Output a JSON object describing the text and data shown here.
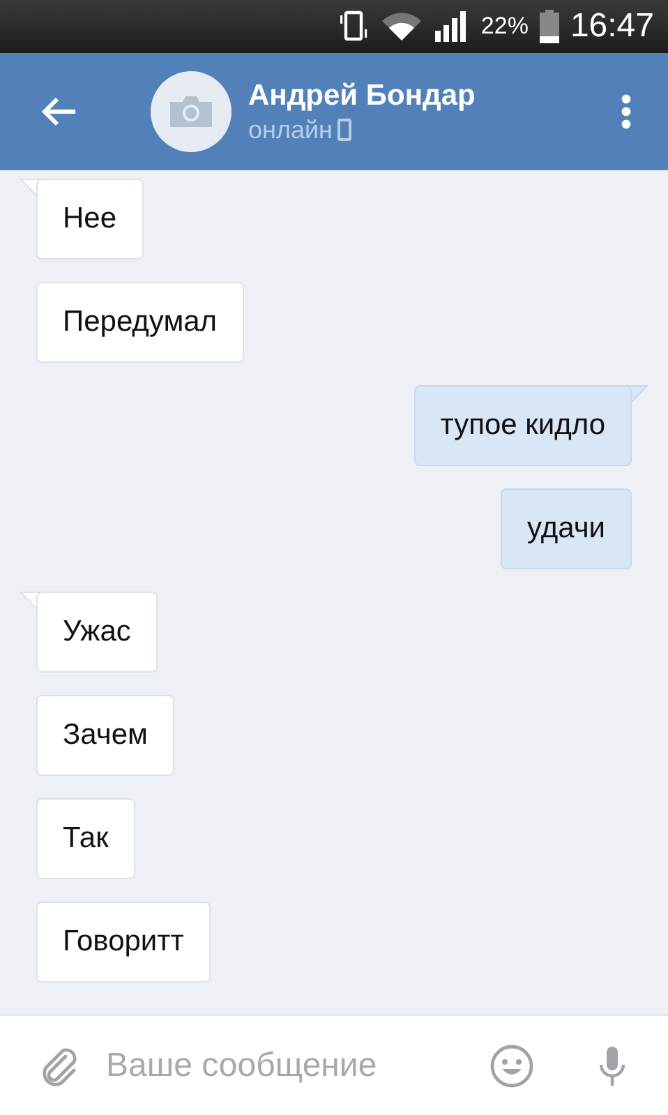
{
  "status_bar": {
    "battery": "22%",
    "time": "16:47"
  },
  "header": {
    "name": "Андрей Бондар",
    "status": "онлайн"
  },
  "messages": [
    {
      "text": "Нее",
      "outgoing": false,
      "tail": true
    },
    {
      "text": "Передумал",
      "outgoing": false,
      "tail": false
    },
    {
      "text": "тупое кидло",
      "outgoing": true,
      "tail": true
    },
    {
      "text": "удачи",
      "outgoing": true,
      "tail": false
    },
    {
      "text": "Ужас",
      "outgoing": false,
      "tail": true
    },
    {
      "text": "Зачем",
      "outgoing": false,
      "tail": false
    },
    {
      "text": "Так",
      "outgoing": false,
      "tail": false
    },
    {
      "text": "Говоритт",
      "outgoing": false,
      "tail": false
    }
  ],
  "composer": {
    "placeholder": "Ваше сообщение"
  }
}
